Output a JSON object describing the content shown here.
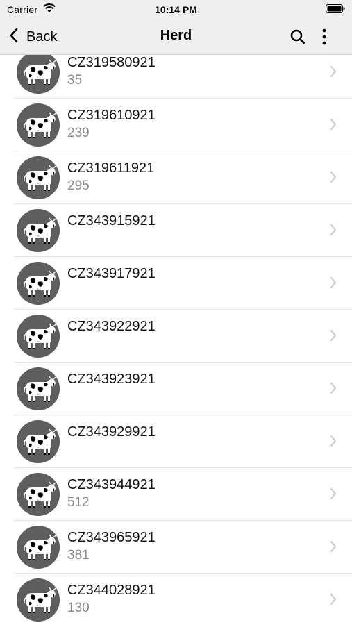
{
  "status_bar": {
    "carrier": "Carrier",
    "time": "10:14 PM"
  },
  "nav": {
    "back_label": "Back",
    "title": "Herd",
    "icons": [
      "chevron-left-icon",
      "search-icon",
      "more-vertical-icon"
    ]
  },
  "animals": [
    {
      "id": "CZ319580921",
      "number": "35"
    },
    {
      "id": "CZ319610921",
      "number": "239"
    },
    {
      "id": "CZ319611921",
      "number": "295"
    },
    {
      "id": "CZ343915921",
      "number": ""
    },
    {
      "id": "CZ343917921",
      "number": ""
    },
    {
      "id": "CZ343922921",
      "number": ""
    },
    {
      "id": "CZ343923921",
      "number": ""
    },
    {
      "id": "CZ343929921",
      "number": ""
    },
    {
      "id": "CZ343944921",
      "number": "512"
    },
    {
      "id": "CZ343965921",
      "number": "381"
    },
    {
      "id": "CZ344028921",
      "number": "130"
    }
  ],
  "colors": {
    "bar_background": "#efefef",
    "avatar_background": "#5e5e5e",
    "subtitle": "#8a8a8a",
    "chevron": "#c7c7cc"
  }
}
